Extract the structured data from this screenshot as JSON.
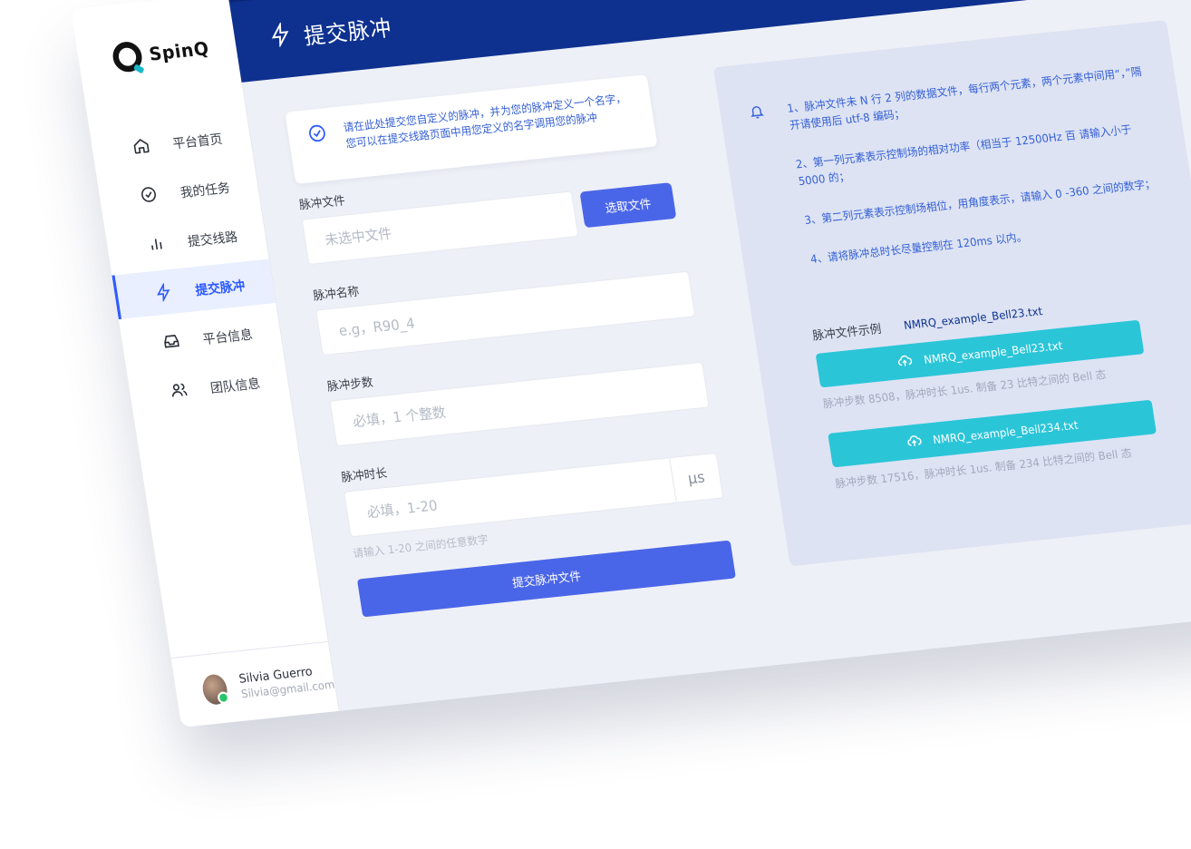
{
  "app": {
    "brand": "SpinQ",
    "page_title": "提交脉冲"
  },
  "sidebar": {
    "items": [
      {
        "label": "平台首页",
        "icon": "home-icon"
      },
      {
        "label": "我的任务",
        "icon": "check-circle-icon"
      },
      {
        "label": "提交线路",
        "icon": "bar-chart-icon"
      },
      {
        "label": "提交脉冲",
        "icon": "lightning-icon",
        "active": true
      },
      {
        "label": "平台信息",
        "icon": "inbox-icon"
      },
      {
        "label": "团队信息",
        "icon": "users-icon"
      }
    ],
    "user": {
      "name": "Silvia Guerro",
      "email": "Silvia@gmail.com"
    }
  },
  "notice": {
    "text": "请在此处提交您自定义的脉冲，并为您的脉冲定义一个名字，您可以在提交线路页面中用您定义的名字调用您的脉冲"
  },
  "form": {
    "file_label": "脉冲文件",
    "file_placeholder": "未选中文件",
    "pick_button": "选取文件",
    "name_label": "脉冲名称",
    "name_placeholder": "e.g，R90_4",
    "steps_label": "脉冲步数",
    "steps_placeholder": "必填，1 个整数",
    "duration_label": "脉冲时长",
    "duration_placeholder": "必填，1-20",
    "duration_unit": "μs",
    "duration_hint": "请输入 1-20 之间的任意数字",
    "submit_button": "提交脉冲文件"
  },
  "info": {
    "rules": [
      "1、脉冲文件未 N 行 2 列的数据文件，每行两个元素，两个元素中间用“，”隔开请使用后 utf-8 编码；",
      "2、第一列元素表示控制场的相对功率（相当于 12500Hz 百 请输入小于 5000 的；",
      "3、第二列元素表示控制场相位，用角度表示，请输入 0 -360 之间的数字；",
      "4、请将脉冲总时长尽量控制在 120ms 以内。"
    ],
    "example_label": "脉冲文件示例",
    "example_file": "NMRQ_example_Bell23.txt",
    "downloads": [
      {
        "label": "NMRQ_example_Bell23.txt",
        "desc": "脉冲步数 8508，脉冲时长 1us. 制备 23 比特之间的 Bell 态"
      },
      {
        "label": "NMRQ_example_Bell234.txt",
        "desc": "脉冲步数 17516，脉冲时长 1us. 制备 234 比特之间的 Bell 态"
      }
    ]
  },
  "colors": {
    "header": "#0e3190",
    "accent": "#4a66e8",
    "download": "#2bc5d8",
    "panel": "#dde3f3"
  }
}
